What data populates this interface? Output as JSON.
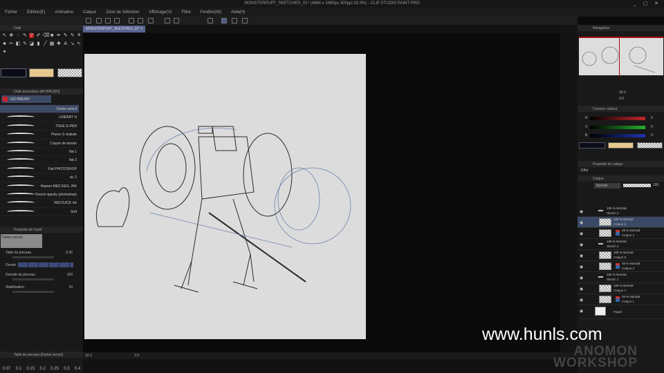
{
  "title": "MONSTERPUFF_SKETCHES_01* (4684 x 2480px 300ppi 33.3%) - CLIP STUDIO PAINT PRO",
  "menu": [
    "Fichier",
    "Édition(E)",
    "Animation",
    "Calque",
    "Zone de Sélection",
    "Affichage(V)",
    "Filtre",
    "Fenêtre(W)",
    "Aide(H)"
  ],
  "doc_tab": "MONSTERPUFF_SKETCHES_01* ×",
  "left": {
    "tool_header": "Outil",
    "sub_tool_header": "Outil secondaire [AH BRUSH]",
    "brush_group": "LED BRUSH",
    "brushes": [
      "Darker pencil",
      "LINEART N",
      "TRUE G-PEN",
      "Plume G réaliste",
      "Crayon de dessin",
      "flat 1",
      "flat 2",
      "Flat PHOTOSHOP",
      "sic 2",
      "#hpmm MED REG. INK",
      "Round opacity (photoshop)",
      "REDJUICE ink",
      "Soft"
    ],
    "props_header": "Propriété de l'outil",
    "props_preview": "Darker pencil",
    "props": [
      {
        "label": "Taille du pinceau",
        "value": "0.35"
      },
      {
        "label": "Dureté",
        "value": ""
      },
      {
        "label": "Densité du pinceau",
        "value": "100"
      },
      {
        "label": "Stabilisation",
        "value": "10"
      }
    ],
    "size_header": "Taille de pinceau [Darker pencil]",
    "sizes": [
      "0.07",
      "0.1",
      "0.15",
      "0.2",
      "0.25",
      "0.3",
      "0.4"
    ]
  },
  "colors": {
    "main": "#0a0c18",
    "sub": "#e6c98e",
    "red": "#c0262a",
    "green": "#27b02e",
    "blue": "#1e33b0"
  },
  "status": {
    "zoom": "33.3",
    "angle": "2.0"
  },
  "right": {
    "navigator_header": "Navigateur",
    "nav_zoom": "33.3",
    "nav_angle": "0.0",
    "color_header": "Curseur couleur",
    "rgb": [
      {
        "label": "R",
        "value": "0"
      },
      {
        "label": "V",
        "value": "0"
      },
      {
        "label": "B",
        "value": "0"
      }
    ],
    "layer_prop_header": "Propriété du calque",
    "effect_label": "Effet",
    "layer_header": "Calque",
    "blend_mode": "Normal",
    "opacity": "100",
    "layers": [
      {
        "line1": "100 % Normal",
        "line2": "Sketch 3",
        "folder": true,
        "indent": 0
      },
      {
        "line1": "100 % Normal",
        "line2": "Calque 6",
        "indent": 1,
        "selected": true
      },
      {
        "line1": "45 % Normal",
        "line2": "Calque 3",
        "indent": 2
      },
      {
        "line1": "100 % Normal",
        "line2": "Sketch 2",
        "folder": true,
        "indent": 0
      },
      {
        "line1": "100 % Normal",
        "line2": "Calque 5",
        "indent": 1
      },
      {
        "line1": "45 % Normal",
        "line2": "Calque 2",
        "indent": 2
      },
      {
        "line1": "100 % Normal",
        "line2": "Sketch 1",
        "folder": true,
        "indent": 0
      },
      {
        "line1": "100 % Normal",
        "line2": "Calque 4",
        "indent": 1
      },
      {
        "line1": "33 % Normal",
        "line2": "Calque 1",
        "indent": 2
      },
      {
        "line1": "",
        "line2": "Papier",
        "paper": true,
        "indent": 0
      }
    ]
  },
  "watermark": "www.hunls.com",
  "logo": "ANOMON WORKSHOP"
}
